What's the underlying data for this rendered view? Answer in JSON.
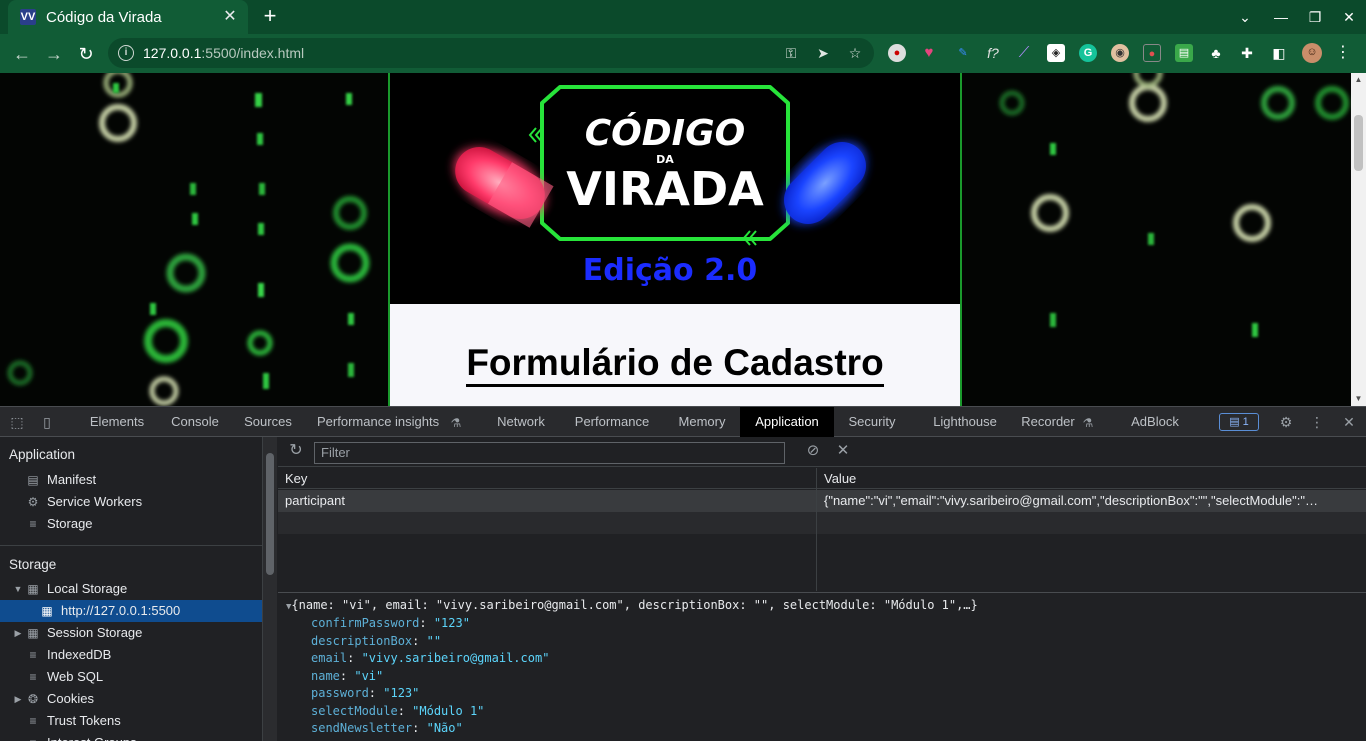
{
  "browser": {
    "tab_title": "Código da Virada",
    "tab_favicon": "VV",
    "url_host": "127.0.0.1",
    "url_rest": ":5500/index.html"
  },
  "page": {
    "banner_title_line1": "CÓDIGO",
    "banner_title_da": "DA",
    "banner_title_line2": "VIRADA",
    "banner_edition": "Edição 2.0",
    "form_title": "Formulário de Cadastro"
  },
  "devtools": {
    "tabs": [
      "Elements",
      "Console",
      "Sources",
      "Performance insights",
      "Network",
      "Performance",
      "Memory",
      "Application",
      "Security",
      "Lighthouse",
      "Recorder",
      "AdBlock"
    ],
    "active_tab": "Application",
    "issues_count": "1",
    "sidebar": {
      "application_header": "Application",
      "manifest": "Manifest",
      "service_workers": "Service Workers",
      "storage_item": "Storage",
      "storage_header": "Storage",
      "local_storage": "Local Storage",
      "local_storage_origin": "http://127.0.0.1:5500",
      "session_storage": "Session Storage",
      "indexeddb": "IndexedDB",
      "web_sql": "Web SQL",
      "cookies": "Cookies",
      "trust_tokens": "Trust Tokens",
      "interest_groups": "Interest Groups"
    },
    "filter_placeholder": "Filter",
    "table": {
      "key_header": "Key",
      "value_header": "Value",
      "rows": [
        {
          "key": "participant",
          "value": "{\"name\":\"vi\",\"email\":\"vivy.saribeiro@gmail.com\",\"descriptionBox\":\"\",\"selectModule\":\"…"
        }
      ]
    },
    "preview": {
      "summary": "{name: \"vi\", email: \"vivy.saribeiro@gmail.com\", descriptionBox: \"\", selectModule: \"Módulo 1\",…}",
      "fields": [
        {
          "key": "confirmPassword",
          "value": "\"123\""
        },
        {
          "key": "descriptionBox",
          "value": "\"\""
        },
        {
          "key": "email",
          "value": "\"vivy.saribeiro@gmail.com\""
        },
        {
          "key": "name",
          "value": "\"vi\""
        },
        {
          "key": "password",
          "value": "\"123\""
        },
        {
          "key": "selectModule",
          "value": "\"Módulo 1\""
        },
        {
          "key": "sendNewsletter",
          "value": "\"Não\""
        }
      ]
    }
  },
  "colors": {
    "chrome_frame": "#0b4a2b",
    "chrome_toolbar": "#115c36",
    "devtools_bg": "#202124",
    "selection": "#0f4c8f",
    "banner_green": "#27e43a",
    "edition_blue": "#1b2cff"
  }
}
